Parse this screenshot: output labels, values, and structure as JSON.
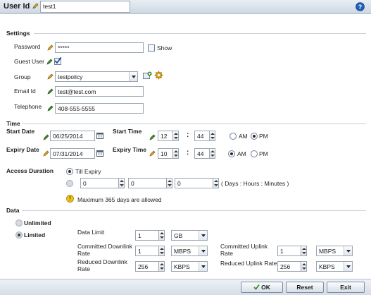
{
  "header": {
    "user_id_label": "User Id",
    "user_id_value": "test1",
    "help_icon": "help-icon"
  },
  "settings": {
    "title": "Settings",
    "password_label": "Password",
    "password_value": "*****",
    "show_label": "Show",
    "show_checked": false,
    "guest_user_label": "Guest User",
    "guest_user_checked": true,
    "group_label": "Group",
    "group_value": "testpolicy",
    "email_label": "Email Id",
    "email_value": "test@test.com",
    "telephone_label": "Telephone",
    "telephone_value": "408-555-5555"
  },
  "time": {
    "title": "Time",
    "start_date_label": "Start Date",
    "start_date_value": "06/25/2014",
    "start_time_label": "Start Time",
    "start_hour": "12",
    "start_minute": "44",
    "start_ampm_selected": "PM",
    "expiry_date_label": "Expiry Date",
    "expiry_date_value": "07/31/2014",
    "expiry_time_label": "Expiry Time",
    "expiry_hour": "10",
    "expiry_minute": "44",
    "expiry_ampm_selected": "AM",
    "separator": ":",
    "am_label": "AM",
    "pm_label": "PM"
  },
  "access_duration": {
    "label": "Access Duration",
    "till_expiry_label": "Till Expiry",
    "days": "0",
    "hours": "0",
    "minutes": "0",
    "format_hint": "( Days : Hours : Minutes )",
    "warning": "Maximum 365 days are allowed"
  },
  "data": {
    "title": "Data",
    "unlimited_label": "Unlimited",
    "limited_label": "Limited",
    "selected": "Limited",
    "data_limit_label": "Data Limit",
    "data_limit_value": "1",
    "data_limit_unit": "GB",
    "committed_downlink_label_1": "Committed Downlink",
    "committed_downlink_label_2": "Rate",
    "committed_downlink_value": "1",
    "committed_downlink_unit": "MBPS",
    "committed_uplink_label_1": "Committed Uplink",
    "committed_uplink_label_2": "Rate",
    "committed_uplink_value": "1",
    "committed_uplink_unit": "MBPS",
    "reduced_downlink_label_1": "Reduced Downlink",
    "reduced_downlink_label_2": "Rate",
    "reduced_downlink_value": "256",
    "reduced_downlink_unit": "KBPS",
    "reduced_uplink_label": "Reduced Uplink Rate",
    "reduced_uplink_value": "256",
    "reduced_uplink_unit": "KBPS"
  },
  "footer": {
    "ok_label": "OK",
    "reset_label": "Reset",
    "exit_label": "Exit"
  },
  "colors": {
    "header_bg": "#cdd7e3",
    "pencil_green": "#3f8a2a",
    "help_blue": "#1f5fb8"
  }
}
